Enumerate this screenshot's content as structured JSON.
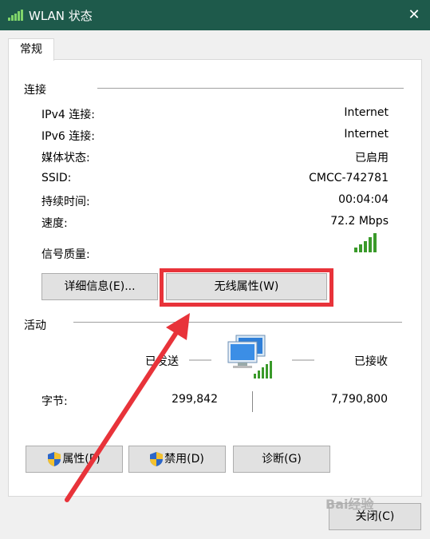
{
  "window": {
    "title": "WLAN 状态",
    "close_glyph": "✕"
  },
  "tabs": [
    {
      "label": "常规"
    }
  ],
  "connection": {
    "section_title": "连接",
    "rows": [
      {
        "label": "IPv4 连接:",
        "value": "Internet"
      },
      {
        "label": "IPv6 连接:",
        "value": "Internet"
      },
      {
        "label": "媒体状态:",
        "value": "已启用"
      },
      {
        "label": "SSID:",
        "value": "CMCC-742781"
      },
      {
        "label": "持续时间:",
        "value": "00:04:04"
      },
      {
        "label": "速度:",
        "value": "72.2 Mbps"
      }
    ],
    "signal_label": "信号质量:",
    "signal_bars": 5,
    "details_button": "详细信息(E)...",
    "wireless_props_button": "无线属性(W)"
  },
  "activity": {
    "section_title": "活动",
    "sent_label": "已发送",
    "received_label": "已接收",
    "bytes_label": "字节:",
    "bytes_sent": "299,842",
    "bytes_received": "7,790,800"
  },
  "buttons": {
    "properties": "属性(P)",
    "disable": "禁用(D)",
    "diagnose": "诊断(G)",
    "close": "关闭(C)"
  },
  "colors": {
    "titlebar": "#1e5a4b",
    "highlight": "#e8333a",
    "signal": "#3a9a2a"
  },
  "watermark": "Bai经验"
}
